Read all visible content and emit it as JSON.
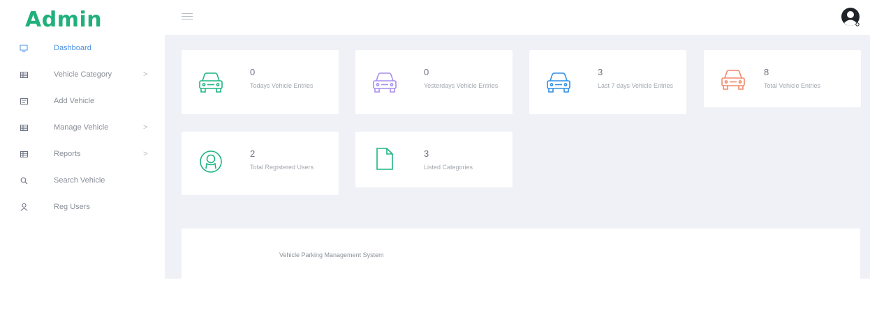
{
  "brand": {
    "title": "Admin",
    "color": "#21b07a"
  },
  "topbar": {
    "menu_icon": "hamburger-icon",
    "avatar_icon": "user-circle-icon"
  },
  "sidebar": {
    "items": [
      {
        "label": "Dashboard",
        "icon": "monitor-icon",
        "active": true,
        "chevron": ""
      },
      {
        "label": "Vehicle Category",
        "icon": "table-icon",
        "active": false,
        "chevron": ">"
      },
      {
        "label": "Add Vehicle",
        "icon": "list-icon",
        "active": false,
        "chevron": ""
      },
      {
        "label": "Manage Vehicle",
        "icon": "table-icon",
        "active": false,
        "chevron": ">"
      },
      {
        "label": "Reports",
        "icon": "table-icon",
        "active": false,
        "chevron": ">"
      },
      {
        "label": "Search Vehicle",
        "icon": "search-icon",
        "active": false,
        "chevron": ""
      },
      {
        "label": "Reg Users",
        "icon": "user-icon",
        "active": false,
        "chevron": ""
      }
    ]
  },
  "cards": [
    {
      "value": "0",
      "label": "Todays Vehicle Entries",
      "icon": "car-icon",
      "color": "#1fb584"
    },
    {
      "value": "0",
      "label": "Yesterdays Vehicle Entries",
      "icon": "car-icon",
      "color": "#a98ef0"
    },
    {
      "value": "3",
      "label": "Last 7 days Vehicle Entries",
      "icon": "car-icon",
      "color": "#2f8fe6"
    },
    {
      "value": "8",
      "label": "Total Vehicle Entries",
      "icon": "car-icon",
      "color": "#f08a6c"
    },
    {
      "value": "2",
      "label": "Total Registered Users",
      "icon": "user-circle-icon",
      "color": "#1fb584"
    },
    {
      "value": "3",
      "label": "Listed Categories",
      "icon": "file-icon",
      "color": "#1fb584"
    }
  ],
  "footer": {
    "text": "Vehicle Parking Management System"
  }
}
